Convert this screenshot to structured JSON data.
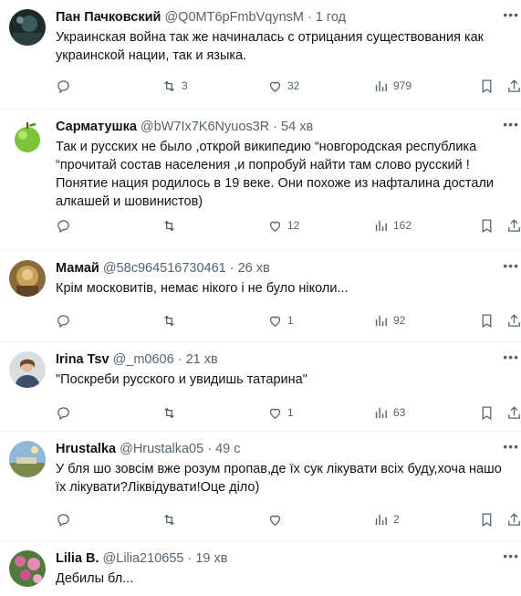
{
  "tweets": [
    {
      "name": "Пан Пачковский",
      "meta": "@Q0MT6pFmbVqynsM · 1 год",
      "lines": [
        "Украинская война так же начиналась с отрицания существования как",
        "украинской нации, так и языка."
      ],
      "replies": "",
      "retweets": "3",
      "likes": "32",
      "views": "979",
      "avatar": "dark-photo"
    },
    {
      "name": "Сарматушка",
      "meta": "@bW7Ix7K6Nyuos3R · 54 хв",
      "lines": [
        "Так и русских не было ,открой википедию “новгородская республика",
        "“прочитай состав населения ,и попробуй найти там слово русский !",
        "Понятие нация родилось в 19 веке. Они похоже  из нафталина достали",
        "алкашей и шовинистов)"
      ],
      "replies": "",
      "retweets": "",
      "likes": "12",
      "views": "162",
      "avatar": "green-apple"
    },
    {
      "name": "Мамай",
      "meta": "@58c964516730461 · 26 хв",
      "lines": [
        "Крім московитів, немає нікого і не було ніколи..."
      ],
      "replies": "",
      "retweets": "",
      "likes": "1",
      "views": "92",
      "avatar": "portrait"
    },
    {
      "name": "Irina Tsv",
      "meta": "@_m0606 · 21 хв",
      "lines": [
        "\"Поскреби русского и увидишь татарина\""
      ],
      "replies": "",
      "retweets": "",
      "likes": "1",
      "views": "63",
      "avatar": "woman"
    },
    {
      "name": "Hrustalka",
      "meta": "@Hrustalka05 · 49 с",
      "lines": [
        "У бля шо зовсім вже розум пропав,де їх сук лікувати всіх буду,хоча нашо",
        "їх лікувати?Ліквідувати!Оце діло)"
      ],
      "replies": "",
      "retweets": "",
      "likes": "",
      "views": "2",
      "avatar": "landscape"
    },
    {
      "name": "Lilia B.",
      "meta": "@Lilia210655 · 19 хв",
      "lines": [
        "Дебилы бл..."
      ],
      "replies": "",
      "retweets": "",
      "likes": "",
      "views": "",
      "avatar": "flowers"
    }
  ],
  "icons": {
    "reply": "reply-icon",
    "retweet": "retweet-icon",
    "like": "heart-icon",
    "views": "views-icon",
    "bookmark": "bookmark-icon",
    "share": "share-icon",
    "more": "more-icon"
  },
  "colors": {
    "text": "#0f1419",
    "secondary": "#536471",
    "divider": "#eff3f4"
  }
}
